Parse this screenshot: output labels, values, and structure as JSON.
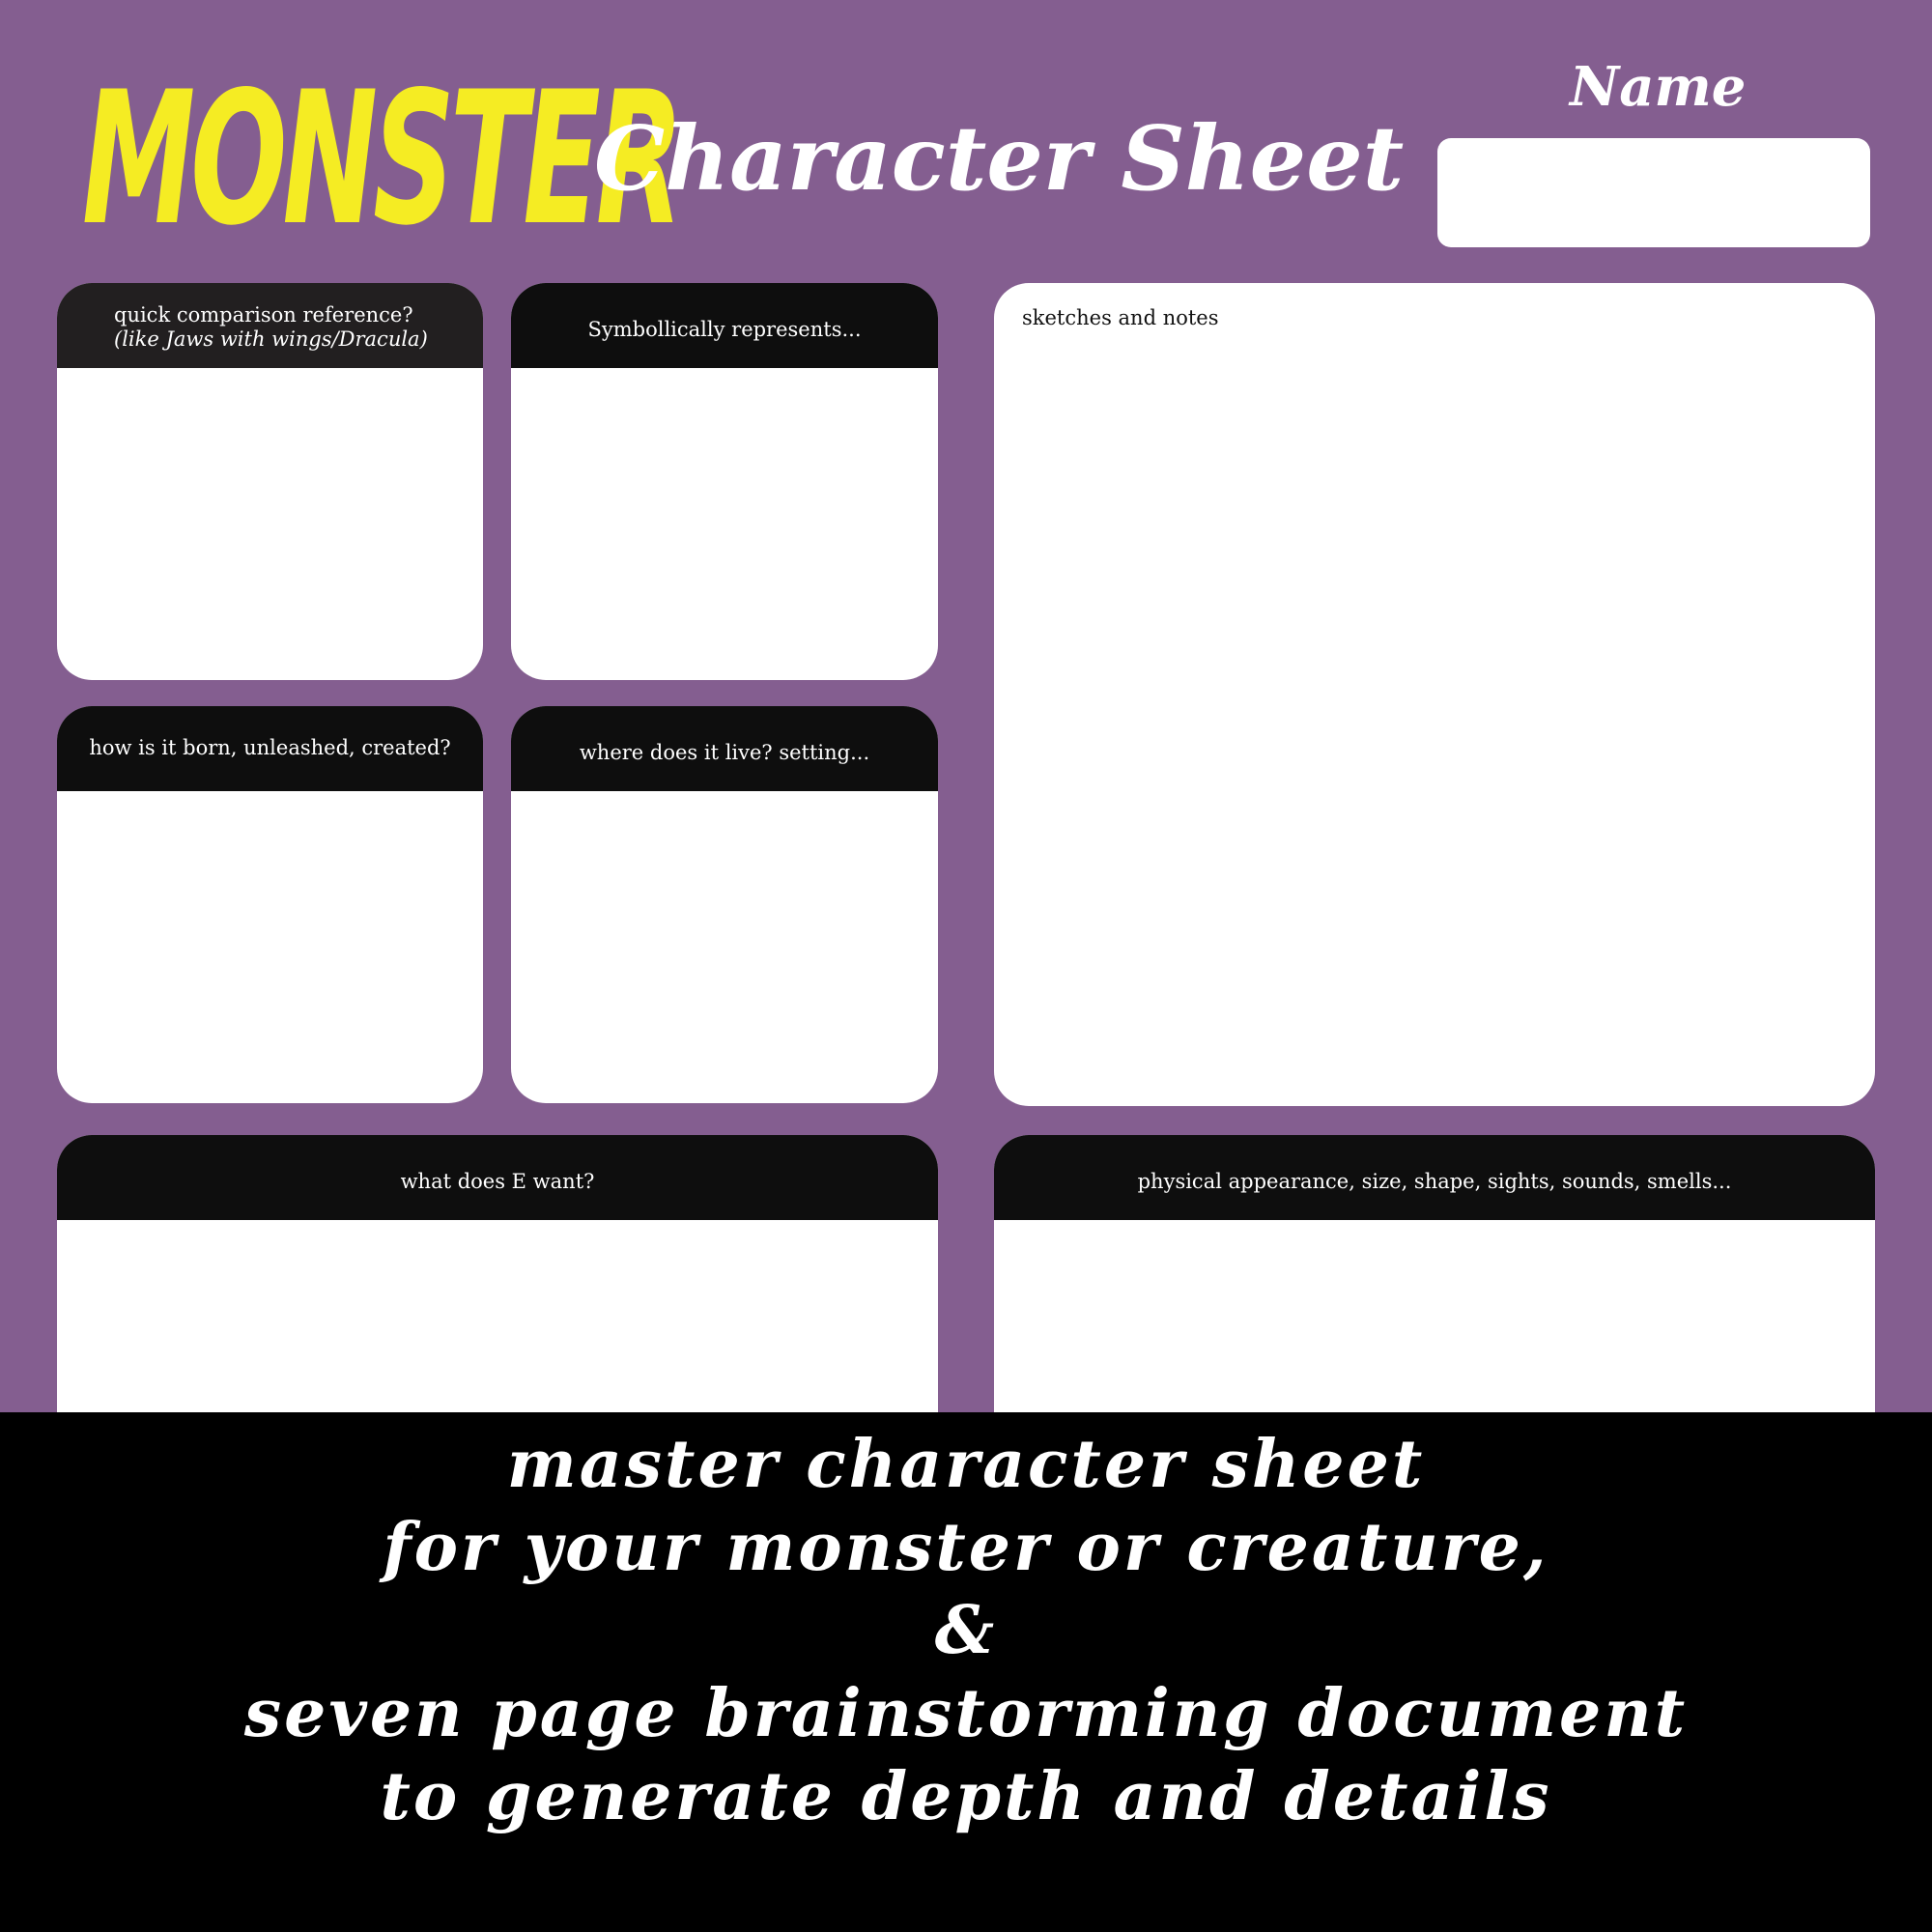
{
  "header": {
    "logo_text": "MONSTER",
    "subtitle": "Character Sheet",
    "name_label": "Name",
    "name_value": ""
  },
  "boxes": {
    "comparison": {
      "label": "quick comparison reference?",
      "hint": "(like Jaws with wings/Dracula)"
    },
    "symbolic": {
      "label": "Symbollically represents..."
    },
    "origin": {
      "label": "how is it born, unleashed, created?"
    },
    "habitat": {
      "label": "where does it live? setting..."
    },
    "sketches": {
      "label": "sketches and notes"
    },
    "want": {
      "label": "what does E want?"
    },
    "appearance": {
      "label": "physical appearance, size, shape, sights, sounds, smells..."
    }
  },
  "banner": {
    "lines": [
      "master character sheet",
      "for your monster or creature,",
      "&",
      "seven page brainstorming document",
      "to generate depth and details"
    ]
  },
  "colors": {
    "background": "#845e90",
    "logo": "#f5ec23",
    "header_bar": "#0e0e0e",
    "card": "#ffffff",
    "banner": "#000000"
  }
}
